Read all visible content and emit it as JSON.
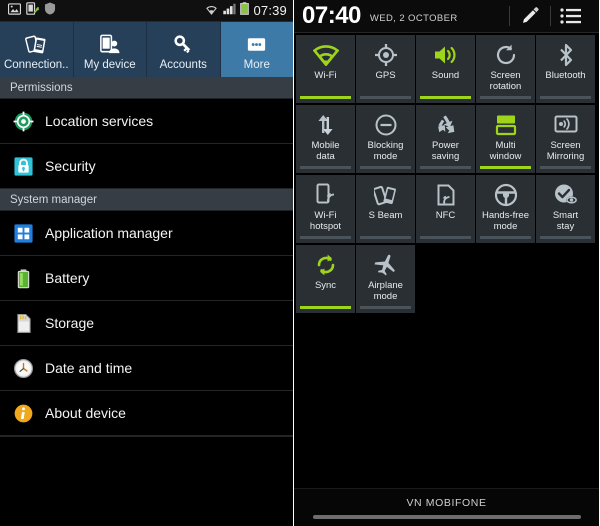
{
  "left_panel": {
    "status_bar": {
      "icons": [
        "image-icon",
        "device-transfer-icon",
        "shield-icon"
      ],
      "wifi_icon": "wifi-signal-icon",
      "signal_icon": "cellular-signal-icon",
      "battery_icon": "battery-icon",
      "clock": "07:39"
    },
    "tabs": [
      {
        "label": "Connection..",
        "icon": "connections-icon",
        "selected": false
      },
      {
        "label": "My device",
        "icon": "my-device-icon",
        "selected": false
      },
      {
        "label": "Accounts",
        "icon": "accounts-key-icon",
        "selected": false
      },
      {
        "label": "More",
        "icon": "more-dots-icon",
        "selected": true
      }
    ],
    "sections": [
      {
        "header": "Permissions",
        "items": [
          {
            "label": "Location services",
            "icon": "location-crosshair-icon"
          },
          {
            "label": "Security",
            "icon": "lock-icon"
          }
        ]
      },
      {
        "header": "System manager",
        "items": [
          {
            "label": "Application manager",
            "icon": "app-grid-icon"
          },
          {
            "label": "Battery",
            "icon": "battery-icon"
          },
          {
            "label": "Storage",
            "icon": "sd-card-icon"
          },
          {
            "label": "Date and time",
            "icon": "clock-icon"
          },
          {
            "label": "About device",
            "icon": "info-icon"
          }
        ]
      }
    ]
  },
  "right_panel": {
    "header": {
      "time": "07:40",
      "date": "WED, 2 OCTOBER",
      "edit_icon": "pencil-edit-icon",
      "list_icon": "list-menu-icon"
    },
    "tiles": [
      {
        "label": "Wi-Fi",
        "icon": "wifi-icon",
        "active": true
      },
      {
        "label": "GPS",
        "icon": "gps-crosshair-icon",
        "active": false
      },
      {
        "label": "Sound",
        "icon": "speaker-sound-icon",
        "active": true
      },
      {
        "label": "Screen\nrotation",
        "icon": "rotate-icon",
        "active": false
      },
      {
        "label": "Bluetooth",
        "icon": "bluetooth-icon",
        "active": false
      },
      {
        "label": "Mobile\ndata",
        "icon": "mobile-data-icon",
        "active": false
      },
      {
        "label": "Blocking\nmode",
        "icon": "blocking-minus-icon",
        "active": false
      },
      {
        "label": "Power\nsaving",
        "icon": "power-saving-icon",
        "active": false
      },
      {
        "label": "Multi\nwindow",
        "icon": "multi-window-icon",
        "active": true
      },
      {
        "label": "Screen\nMirroring",
        "icon": "screen-mirroring-icon",
        "active": false
      },
      {
        "label": "Wi-Fi\nhotspot",
        "icon": "wifi-hotspot-icon",
        "active": false
      },
      {
        "label": "S Beam",
        "icon": "s-beam-icon",
        "active": false
      },
      {
        "label": "NFC",
        "icon": "nfc-icon",
        "active": false
      },
      {
        "label": "Hands-free\nmode",
        "icon": "steering-wheel-icon",
        "active": false
      },
      {
        "label": "Smart\nstay",
        "icon": "smart-stay-eye-icon",
        "active": false
      },
      {
        "label": "Sync",
        "icon": "sync-icon",
        "active": true
      },
      {
        "label": "Airplane\nmode",
        "icon": "airplane-icon",
        "active": false
      }
    ],
    "carrier": "VN MOBIFONE"
  },
  "colors": {
    "tab_selected": "#3d7aa8",
    "tab_unselected": "#27405a",
    "active_green": "#9ed41a",
    "inactive_gray": "#4a5359",
    "tile_bg": "#2a2f33",
    "group_header_bg": "#363d45"
  }
}
